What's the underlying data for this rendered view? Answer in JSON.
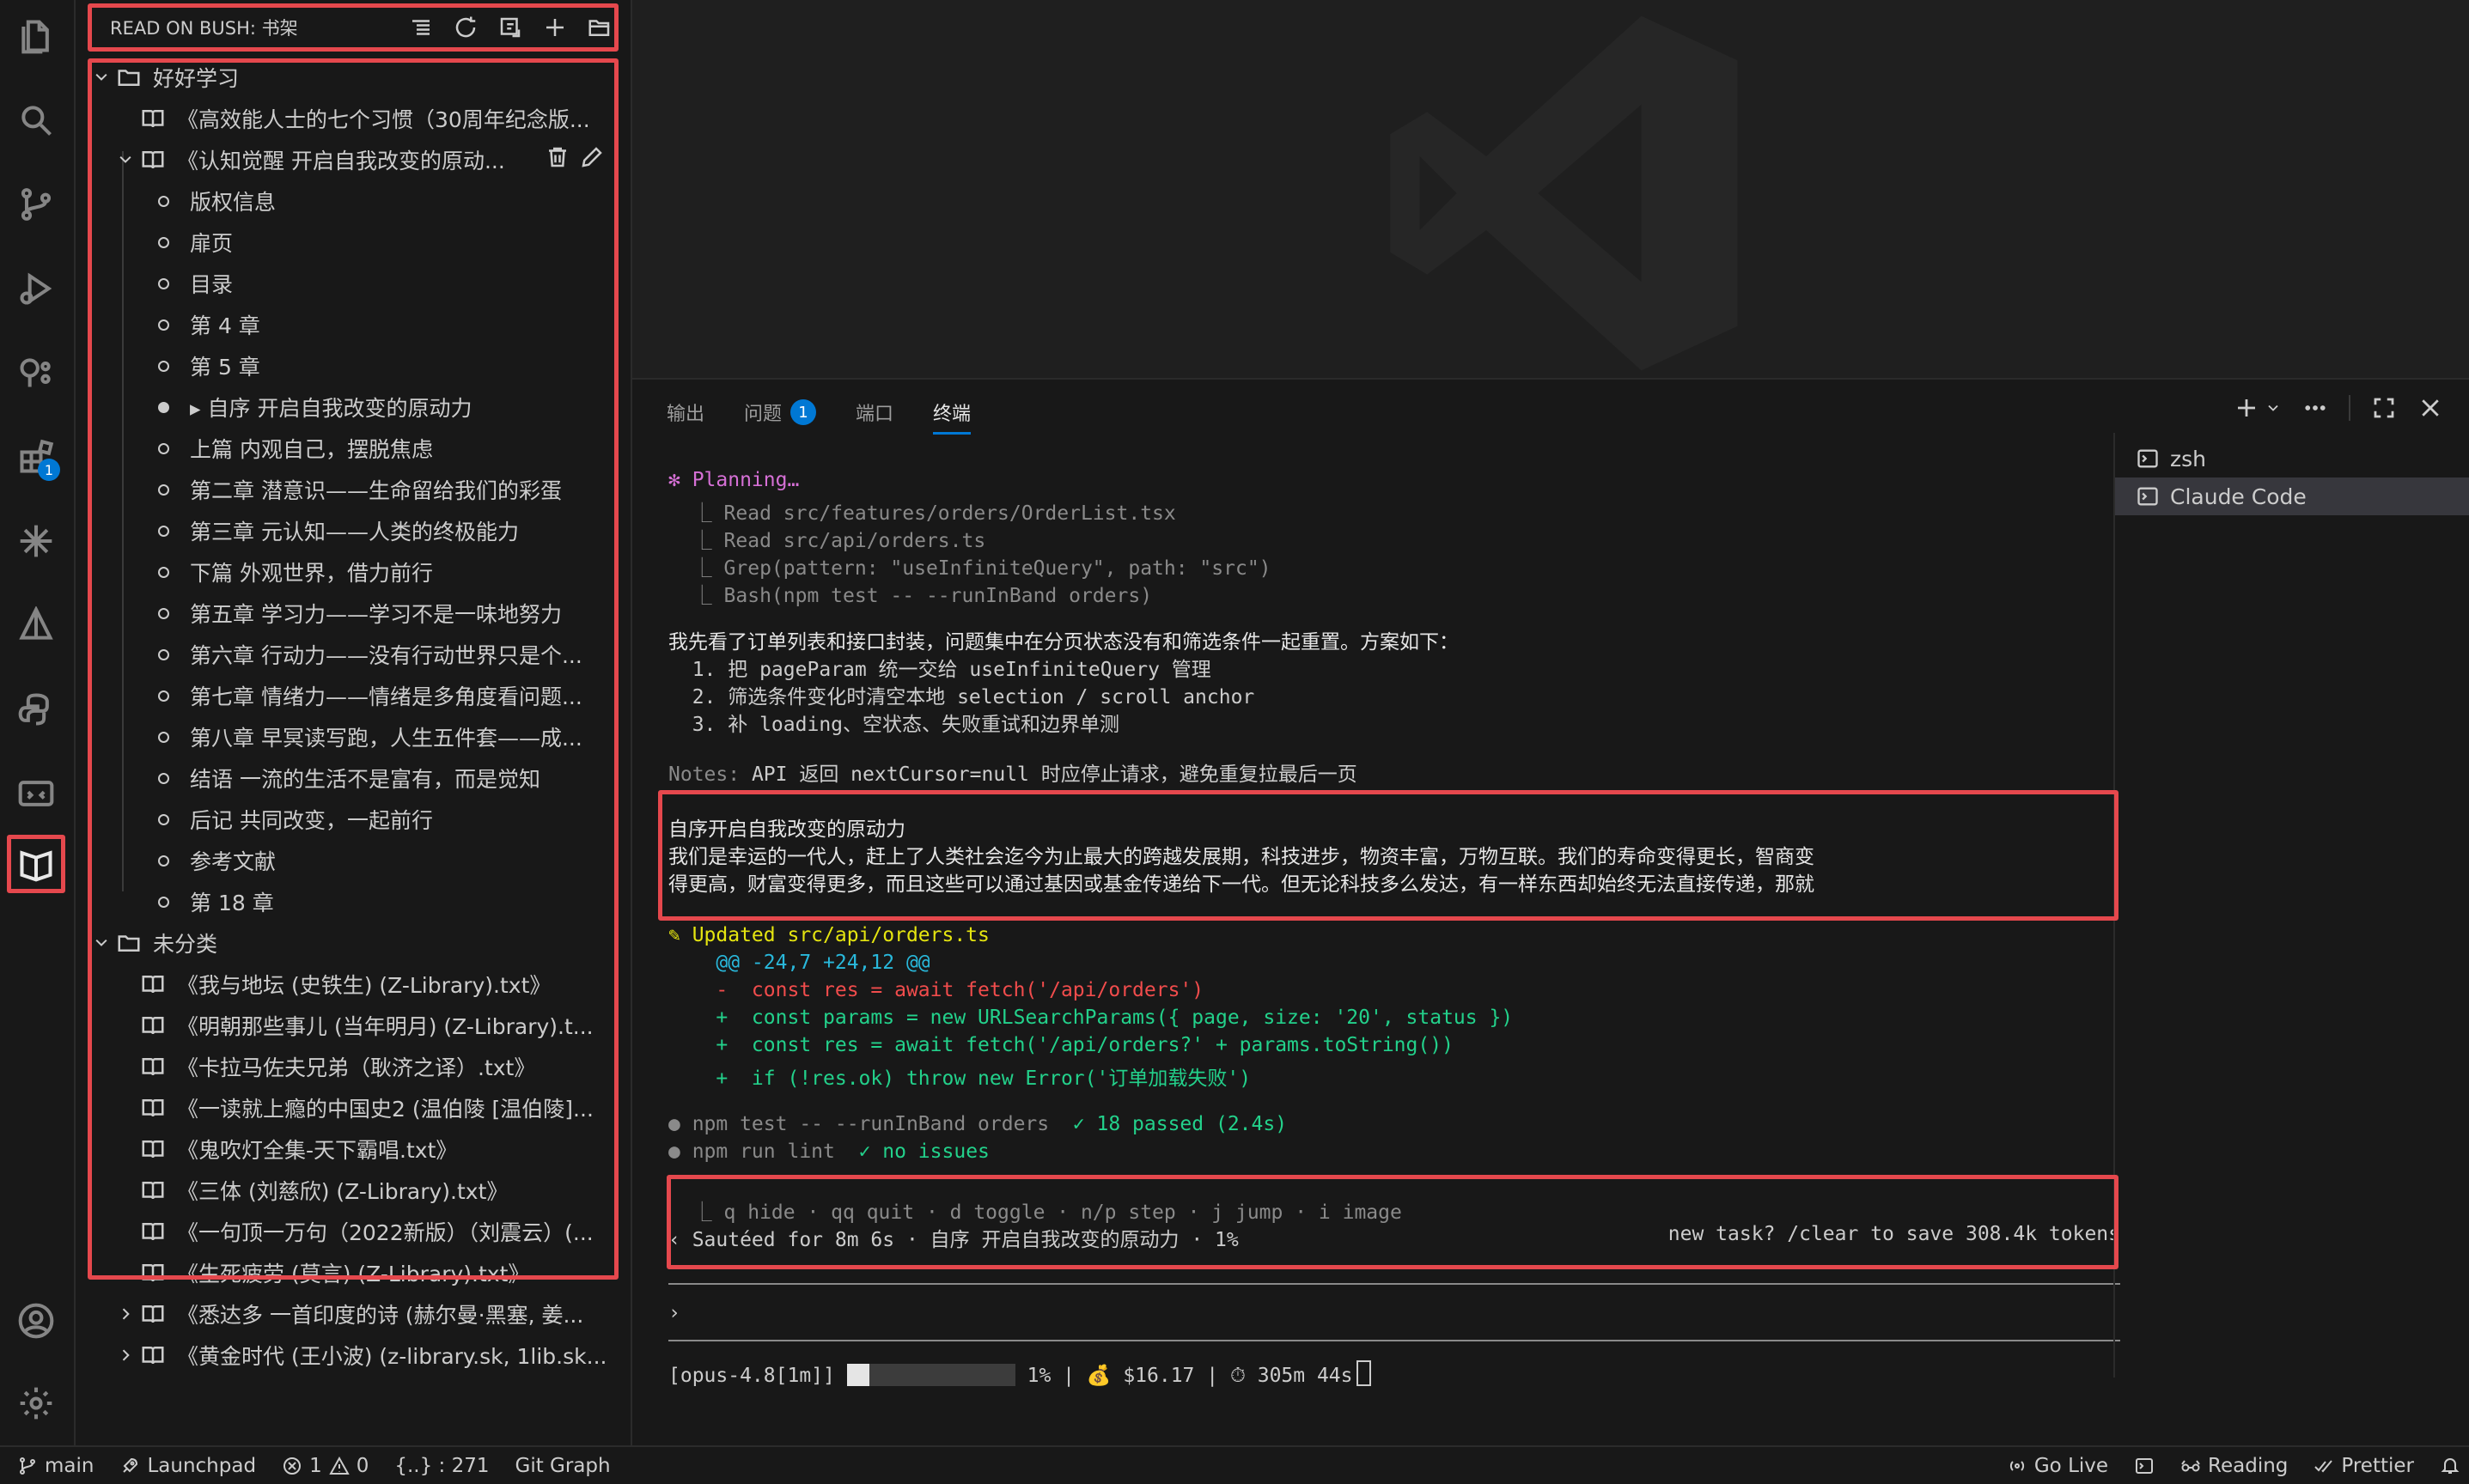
{
  "sidebar": {
    "title": "READ ON BUSH: 书架",
    "header_icons": [
      "list-icon",
      "refresh-icon",
      "import-icon",
      "add-icon",
      "folder-open-icon"
    ],
    "tree": [
      {
        "kind": "folder",
        "label": "好好学习",
        "expanded": true,
        "level": 0
      },
      {
        "kind": "book",
        "label": "《高效能人士的七个习惯（30周年纪念版...",
        "level": 1
      },
      {
        "kind": "book",
        "label": "《认知觉醒  开启自我改变的原动...",
        "expanded": true,
        "level": 1,
        "actions": [
          "trash-icon",
          "pencil-icon"
        ]
      },
      {
        "kind": "chapter",
        "label": "版权信息",
        "level": 2
      },
      {
        "kind": "chapter",
        "label": "扉页",
        "level": 2
      },
      {
        "kind": "chapter",
        "label": "目录",
        "level": 2
      },
      {
        "kind": "chapter",
        "label": "第 4 章",
        "level": 2
      },
      {
        "kind": "chapter",
        "label": "第 5 章",
        "level": 2
      },
      {
        "kind": "chapter",
        "label": "▸ 自序 开启自我改变的原动力",
        "level": 2,
        "current": true
      },
      {
        "kind": "chapter",
        "label": "上篇 内观自己，摆脱焦虑",
        "level": 2
      },
      {
        "kind": "chapter",
        "label": "第二章 潜意识——生命留给我们的彩蛋",
        "level": 2
      },
      {
        "kind": "chapter",
        "label": "第三章 元认知——人类的终极能力",
        "level": 2
      },
      {
        "kind": "chapter",
        "label": "下篇 外观世界，借力前行",
        "level": 2
      },
      {
        "kind": "chapter",
        "label": "第五章 学习力——学习不是一味地努力",
        "level": 2
      },
      {
        "kind": "chapter",
        "label": "第六章 行动力——没有行动世界只是个...",
        "level": 2
      },
      {
        "kind": "chapter",
        "label": "第七章 情绪力——情绪是多角度看问题...",
        "level": 2
      },
      {
        "kind": "chapter",
        "label": "第八章 早冥读写跑，人生五件套——成...",
        "level": 2
      },
      {
        "kind": "chapter",
        "label": "结语 一流的生活不是富有，而是觉知",
        "level": 2
      },
      {
        "kind": "chapter",
        "label": "后记 共同改变，一起前行",
        "level": 2
      },
      {
        "kind": "chapter",
        "label": "参考文献",
        "level": 2
      },
      {
        "kind": "chapter",
        "label": "第 18 章",
        "level": 2
      },
      {
        "kind": "folder",
        "label": "未分类",
        "expanded": true,
        "level": 0
      },
      {
        "kind": "book",
        "label": "《我与地坛 (史铁生) (Z-Library).txt》",
        "level": 1
      },
      {
        "kind": "book",
        "label": "《明朝那些事儿 (当年明月) (Z-Library).t...",
        "level": 1
      },
      {
        "kind": "book",
        "label": "《卡拉马佐夫兄弟（耿济之译）.txt》",
        "level": 1
      },
      {
        "kind": "book",
        "label": "《一读就上瘾的中国史2 (温伯陵 [温伯陵]...",
        "level": 1
      },
      {
        "kind": "book",
        "label": "《鬼吹灯全集-天下霸唱.txt》",
        "level": 1
      },
      {
        "kind": "book",
        "label": "《三体 (刘慈欣) (Z-Library).txt》",
        "level": 1
      },
      {
        "kind": "book",
        "label": "《一句顶一万句（2022新版）（刘震云）(...",
        "level": 1
      },
      {
        "kind": "book",
        "label": "《生死疲劳 (莫言) (Z-Library).txt》",
        "level": 1
      },
      {
        "kind": "book",
        "label": "《悉达多  一首印度的诗 (赫尔曼·黑塞, 姜...",
        "collapsed": true,
        "level": 1
      },
      {
        "kind": "book",
        "label": "《黄金时代 (王小波) (z-library.sk, 1lib.sk...",
        "collapsed": true,
        "level": 1
      }
    ]
  },
  "activity_bar": {
    "items": [
      "files-icon",
      "search-icon",
      "source-control-icon",
      "run-debug-icon",
      "remote-tree-icon",
      "extensions-icon",
      "sparkle-icon",
      "triangle-icon",
      "python-icon",
      "remote-explorer-icon",
      "book-reader-icon"
    ],
    "extensions_badge": "1",
    "bottom": [
      "account-icon",
      "settings-gear-icon"
    ]
  },
  "panel": {
    "tabs": [
      {
        "label": "输出"
      },
      {
        "label": "问题",
        "badge": "1"
      },
      {
        "label": "端口"
      },
      {
        "label": "终端",
        "active": true
      }
    ],
    "terminals": [
      {
        "label": "zsh"
      },
      {
        "label": "Claude Code",
        "selected": true
      }
    ]
  },
  "terminal": {
    "planning": "✻ Planning…",
    "tool_lines": [
      "  ⎿ Read src/features/orders/OrderList.tsx",
      "  ⎿ Read src/api/orders.ts",
      "  ⎿ Grep(pattern: \"useInfiniteQuery\", path: \"src\")",
      "  ⎿ Bash(npm test -- --runInBand orders)"
    ],
    "summary": "我先看了订单列表和接口封装，问题集中在分页状态没有和筛选条件一起重置。方案如下：",
    "plan": [
      "  1. 把 pageParam 统一交给 useInfiniteQuery 管理",
      "  2. 筛选条件变化时清空本地 selection / scroll anchor",
      "  3. 补 loading、空状态、失败重试和边界单测"
    ],
    "notes_label": "Notes:",
    "notes_text": " API 返回 nextCursor=null 时应停止请求，避免重复拉最后一页",
    "reading": [
      "自序开启自我改变的原动力",
      "我们是幸运的一代人，赶上了人类社会迄今为止最大的跨越发展期，科技进步，物资丰富，万物互联。我们的寿命变得更长，智商变",
      "得更高，财富变得更多，而且这些可以通过基因或基金传递给下一代。但无论科技多么发达，有一样东西却始终无法直接传递，那就"
    ],
    "updated": "✎ Updated src/api/orders.ts",
    "hunk": "    @@ -24,7 +24,12 @@",
    "removed": "    -  const res = await fetch('/api/orders')",
    "added": [
      "    +  const params = new URLSearchParams({ page, size: '20', status })",
      "    +  const res = await fetch('/api/orders?' + params.toString())",
      "    +  if (!res.ok) throw new Error('订单加载失败')"
    ],
    "test_cmd": "● npm test -- --runInBand orders",
    "test_result": "  ✓ 18 passed (2.4s)",
    "lint_cmd": "● npm run lint",
    "lint_result": "  ✓ no issues",
    "hints": "  ⎿ q hide · qq quit · d toggle · n/p step · j jump · i image",
    "status_left": "‹ Sautéed for 8m 6s · 自序 开启自我改变的原动力 · 1%",
    "status_right": "new task? /clear to save 308.4k tokens",
    "prompt": "›",
    "footer_model": "[opus-4.8[1m]]",
    "footer_progress": 1,
    "footer_rest": "1% | 💰 $16.17 | ⏱ 305m 44s"
  },
  "statusbar": {
    "branch": "main",
    "launchpad": "Launchpad",
    "errors": "1",
    "warnings": "0",
    "symbols": "{..} : 271",
    "git_graph": "Git Graph",
    "go_live": "Go Live",
    "reading": "Reading",
    "prettier": "Prettier"
  },
  "colors": {
    "highlight_border": "#e5484d",
    "accent": "#0078d4",
    "background": "#1f1f1f"
  }
}
